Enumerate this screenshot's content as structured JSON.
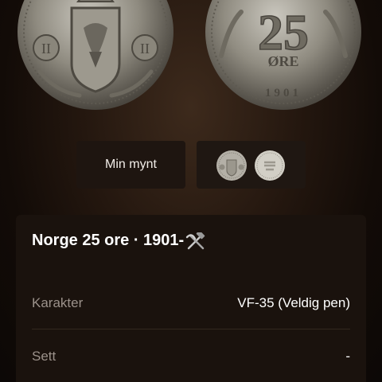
{
  "hero": {
    "coins": [
      {
        "name": "obverse",
        "icon": "coin-obverse-icon"
      },
      {
        "name": "reverse",
        "icon": "coin-reverse-icon",
        "denomination": "25",
        "unit": "ØRE",
        "year": "1901"
      }
    ]
  },
  "tabs": {
    "my_coin_label": "Min mynt",
    "thumbnails_icon": "coin-thumbnails-icon"
  },
  "card": {
    "title": "Norge 25 ore · 1901-",
    "title_icon": "hammer-and-pick-icon",
    "rows": [
      {
        "label": "Karakter",
        "value": "VF-35 (Veldig pen)"
      },
      {
        "label": "Sett",
        "value": "-"
      }
    ]
  },
  "colors": {
    "background": "#160e09",
    "card": "#1a120d",
    "label": "#9b918a",
    "text": "#ffffff"
  }
}
